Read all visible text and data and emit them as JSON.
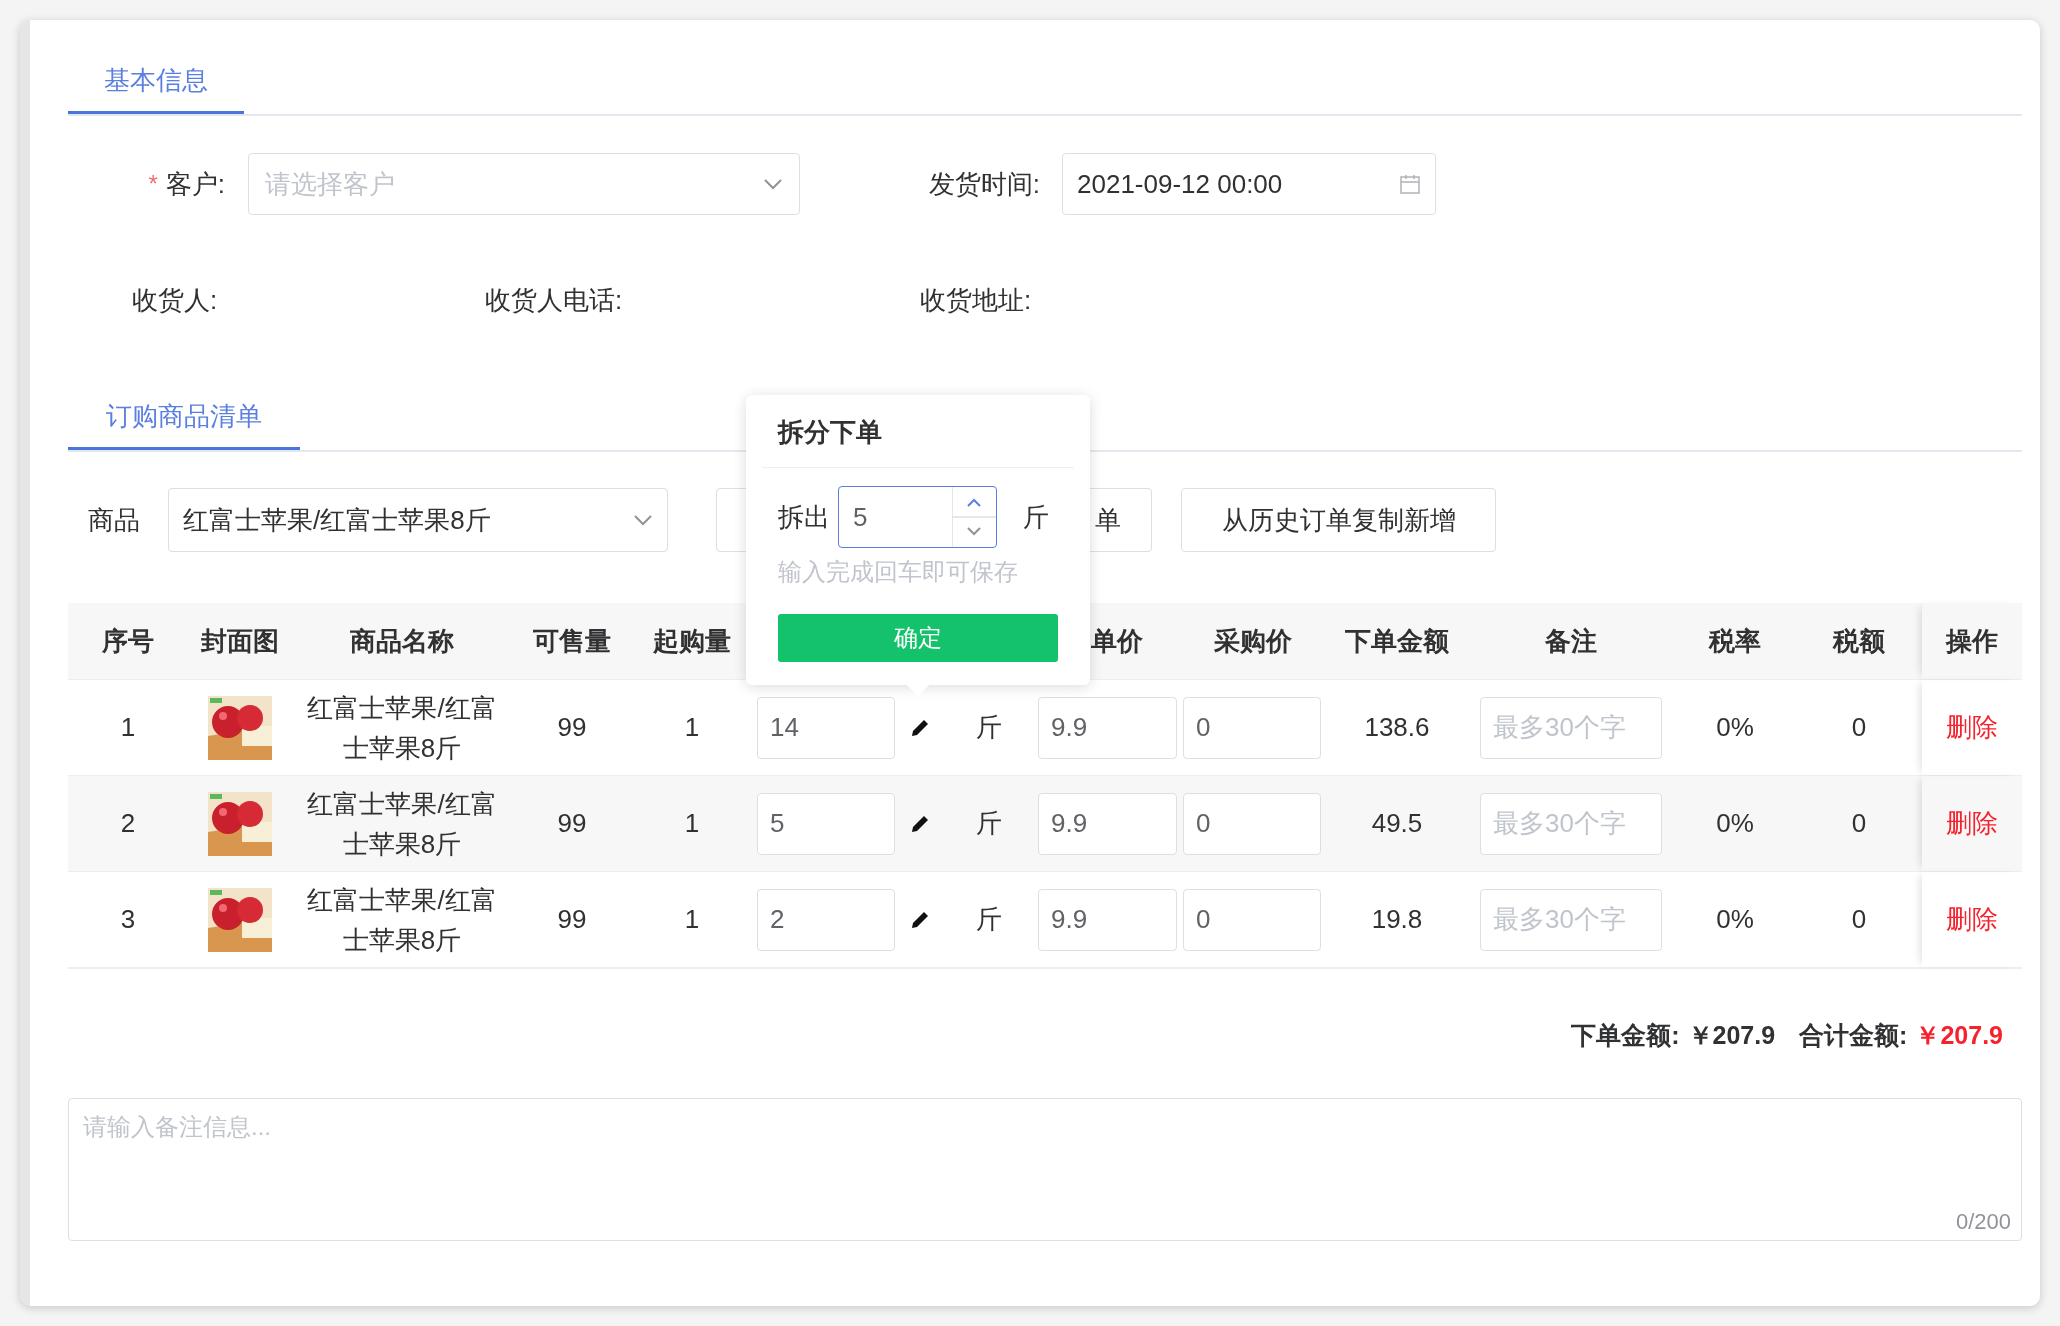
{
  "basic_tabs": [
    {
      "label": "基本信息",
      "selected": true
    }
  ],
  "form": {
    "customer": {
      "required_mark": "*",
      "label": "客户:",
      "placeholder": "请选择客户"
    },
    "ship_time": {
      "label": "发货时间:",
      "value": "2021-09-12 00:00"
    },
    "info": [
      "收货人:",
      "收货人电话:",
      "收货地址:"
    ]
  },
  "goods_tabs": [
    {
      "label": "订购商品清单",
      "selected": true
    }
  ],
  "toolbar": {
    "label": "商品",
    "product": "红富士苹果/红富士苹果8斤",
    "buttons": [
      "单",
      "从历史订单复制新增"
    ]
  },
  "table": {
    "columns": [
      "序号",
      "封面图",
      "商品名称",
      "可售量",
      "起购量",
      "单价",
      "采购价",
      "下单金额",
      "备注",
      "税率",
      "税额",
      "操作"
    ],
    "rows": [
      {
        "index": "1",
        "name": "红富士苹果/红富士苹果8斤",
        "stock": "99",
        "min_qty": "1",
        "qty": "14",
        "unit": "斤",
        "price": "9.9",
        "purchase_price": "0",
        "amount": "138.6",
        "note_placeholder": "最多30个字",
        "tax_rate": "0%",
        "tax": "0",
        "action": "删除"
      },
      {
        "index": "2",
        "name": "红富士苹果/红富士苹果8斤",
        "stock": "99",
        "min_qty": "1",
        "qty": "5",
        "unit": "斤",
        "price": "9.9",
        "purchase_price": "0",
        "amount": "49.5",
        "note_placeholder": "最多30个字",
        "tax_rate": "0%",
        "tax": "0",
        "action": "删除"
      },
      {
        "index": "3",
        "name": "红富士苹果/红富士苹果8斤",
        "stock": "99",
        "min_qty": "1",
        "qty": "2",
        "unit": "斤",
        "price": "9.9",
        "purchase_price": "0",
        "amount": "19.8",
        "note_placeholder": "最多30个字",
        "tax_rate": "0%",
        "tax": "0",
        "action": "删除"
      }
    ]
  },
  "summary": [
    {
      "label": "下单金额:",
      "value": "￥207.9",
      "highlight": false
    },
    {
      "label": "合计金额:",
      "value": "￥207.9",
      "highlight": true
    }
  ],
  "remark": {
    "placeholder": "请输入备注信息...",
    "counter": "0/200"
  },
  "popover": {
    "title": "拆分下单",
    "label": "拆出",
    "value": "5",
    "unit": "斤",
    "hint": "输入完成回车即可保存",
    "confirm": "确定"
  }
}
